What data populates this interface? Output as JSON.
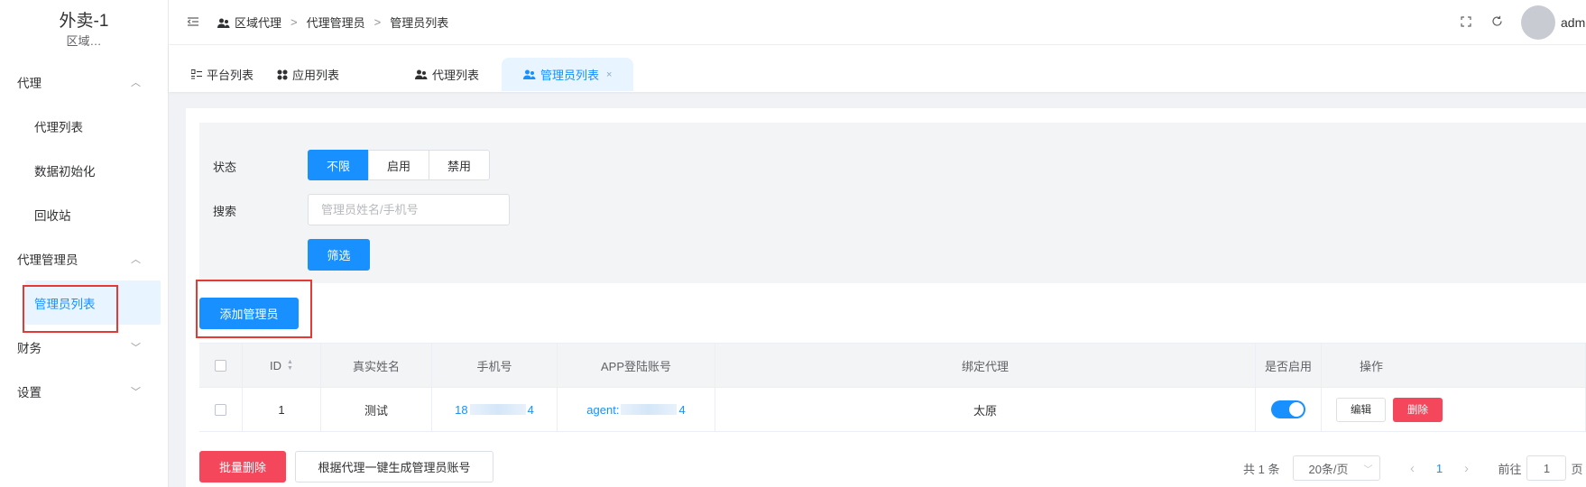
{
  "app": {
    "title": "外卖-1",
    "subtitle": "区域…"
  },
  "sidebar": {
    "groups": [
      {
        "label": "代理",
        "items": [
          "代理列表",
          "数据初始化",
          "回收站"
        ]
      },
      {
        "label": "代理管理员",
        "items": [
          "管理员列表"
        ]
      },
      {
        "label": "财务"
      },
      {
        "label": "设置"
      }
    ]
  },
  "breadcrumb": [
    "区域代理",
    "代理管理员",
    "管理员列表"
  ],
  "breadcrumb_sep": ">",
  "user": {
    "name": "adm"
  },
  "tabs": [
    {
      "label": "平台列表",
      "icon": "list-icon"
    },
    {
      "label": "应用列表",
      "icon": "apps-icon"
    },
    {
      "label": "代理列表",
      "icon": "users-icon"
    },
    {
      "label": "管理员列表",
      "icon": "users-icon",
      "active": true,
      "close": "×"
    }
  ],
  "filters": {
    "status_label": "状态",
    "status_options": [
      "不限",
      "启用",
      "禁用"
    ],
    "status_selected": "不限",
    "search_label": "搜索",
    "search_placeholder": "管理员姓名/手机号",
    "search_value": "",
    "filter_button": "筛选"
  },
  "add_button": "添加管理员",
  "table": {
    "columns": [
      "",
      "ID",
      "真实姓名",
      "手机号",
      "APP登陆账号",
      "绑定代理",
      "是否启用",
      "操作"
    ],
    "rows": [
      {
        "id": "1",
        "real_name": "测试",
        "phone_prefix": "18",
        "phone_suffix": "4",
        "account_prefix": "agent:",
        "account_suffix": "4",
        "agent": "太原",
        "enabled": true,
        "edit_label": "编辑",
        "delete_label": "删除"
      }
    ]
  },
  "bulk_delete_button": "批量删除",
  "generate_button": "根据代理一键生成管理员账号",
  "pagination": {
    "total_text": "共 1 条",
    "page_size": "20条/页",
    "current_page": "1",
    "goto_label": "前往",
    "goto_value": "1",
    "page_unit": "页"
  },
  "colors": {
    "primary": "#1890ff",
    "danger": "#f5475c",
    "highlight_box": "#e53935"
  }
}
